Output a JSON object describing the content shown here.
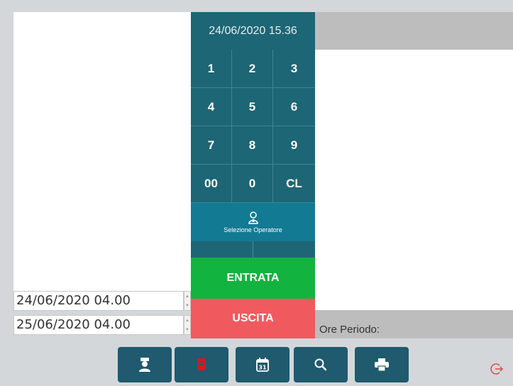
{
  "keypad": {
    "datetime": "24/06/2020 15.36",
    "keys": [
      "1",
      "2",
      "3",
      "4",
      "5",
      "6",
      "7",
      "8",
      "9",
      "00",
      "0",
      "CL"
    ]
  },
  "operator": {
    "label": "Selezione Operatore",
    "icon": "operator-icon"
  },
  "actions": {
    "entrata": "ENTRATA",
    "uscita": "USCITA"
  },
  "period": {
    "start": "24/06/2020 04.00",
    "end": "25/06/2020 04.00",
    "ore_label": "Ore Periodo:"
  },
  "toolbar": {
    "buttons": [
      {
        "icon": "police-officer-icon"
      },
      {
        "icon": "receipt-icon"
      },
      {
        "icon": "calendar-icon",
        "text": "31"
      },
      {
        "icon": "search-icon"
      },
      {
        "icon": "printer-icon"
      }
    ],
    "exit_icon": "logout-icon"
  },
  "colors": {
    "teal": "#1d6675",
    "operator": "#137a94",
    "entrata": "#12b33e",
    "uscita": "#f05a5f",
    "exit": "#e05050"
  }
}
